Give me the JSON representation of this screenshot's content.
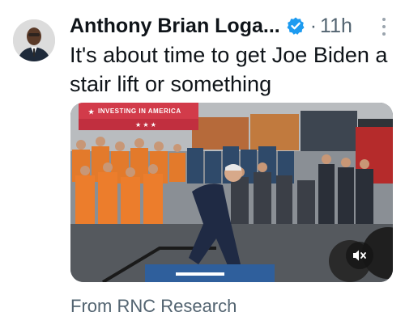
{
  "tweet": {
    "author_name": "Anthony Brian Loga...",
    "timestamp": "11h",
    "separator": "·",
    "text": "It's about time to get Joe Biden a stair lift or something",
    "source_label": "From RNC Research"
  },
  "media": {
    "banner_text": "INVESTING IN AMERICA",
    "mute_icon": "speaker-muted-icon"
  },
  "icons": {
    "verified": "verified-badge-icon",
    "more": "more-options-icon"
  },
  "colors": {
    "verified_blue": "#1d9bf0",
    "secondary_text": "#536471",
    "primary_text": "#0f1419"
  }
}
